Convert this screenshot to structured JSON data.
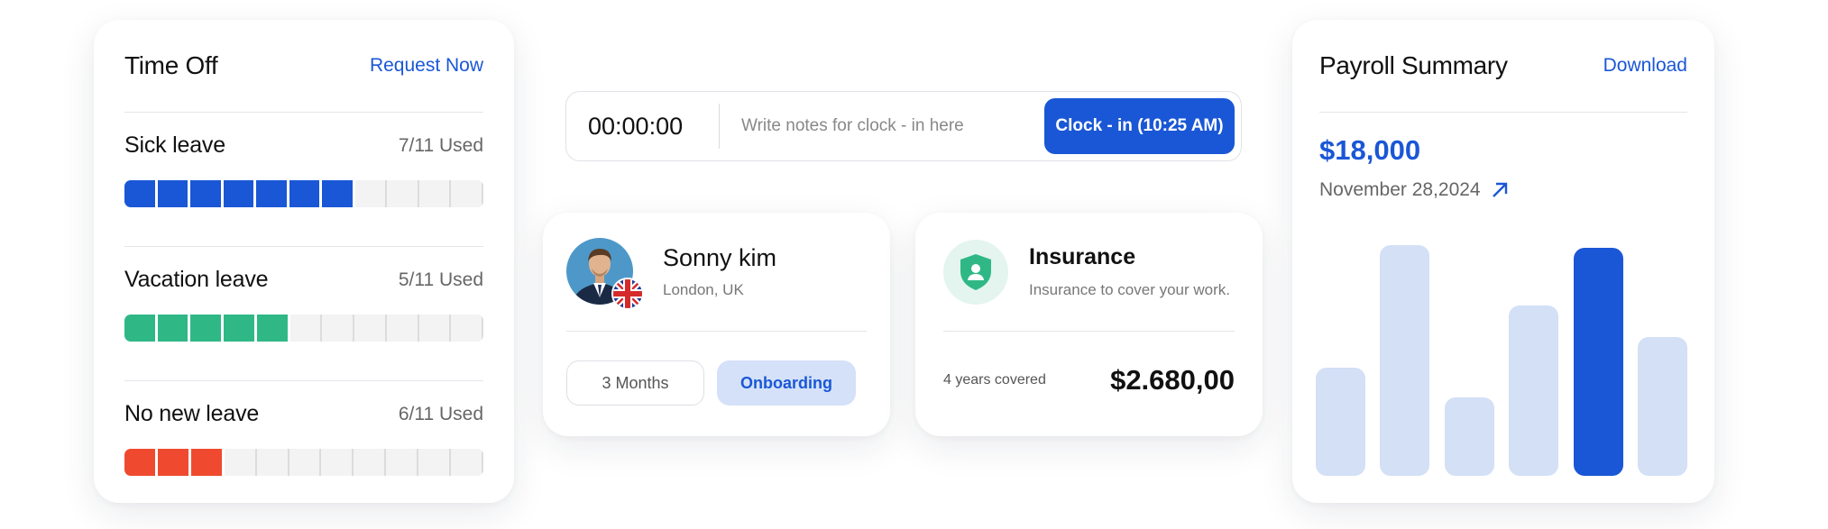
{
  "time_off": {
    "title": "Time Off",
    "action": "Request Now",
    "total_segments": 11,
    "items": [
      {
        "name": "Sick leave",
        "used_label": "7/11 Used",
        "used": 7,
        "color": "#1a57d6"
      },
      {
        "name": "Vacation leave",
        "used_label": "5/11 Used",
        "used": 5,
        "color": "#2fb886"
      },
      {
        "name": "No new leave",
        "used_label": "6/11 Used",
        "used": 3,
        "color": "#ef4a30"
      }
    ]
  },
  "clock": {
    "time": "00:00:00",
    "placeholder": "Write notes for clock - in here",
    "button": "Clock - in (10:25 AM)"
  },
  "profile": {
    "name": "Sonny kim",
    "location": "London, UK",
    "duration": "3 Months",
    "status": "Onboarding"
  },
  "insurance": {
    "title": "Insurance",
    "subtitle": "Insurance to cover your work.",
    "coverage": "4 years covered",
    "amount": "$2.680,00",
    "icon": "shield-user-icon",
    "icon_color": "#2fb886"
  },
  "payroll": {
    "title": "Payroll Summary",
    "action": "Download",
    "amount": "$18,000",
    "date": "November 28,2024"
  },
  "chart_data": {
    "type": "bar",
    "categories": [
      "",
      "",
      "",
      "",
      "",
      ""
    ],
    "values": [
      47,
      100,
      34,
      74,
      99,
      60
    ],
    "highlight_index": 4,
    "colors": {
      "default": "#d3e0f6",
      "highlight": "#1a57d6"
    }
  }
}
